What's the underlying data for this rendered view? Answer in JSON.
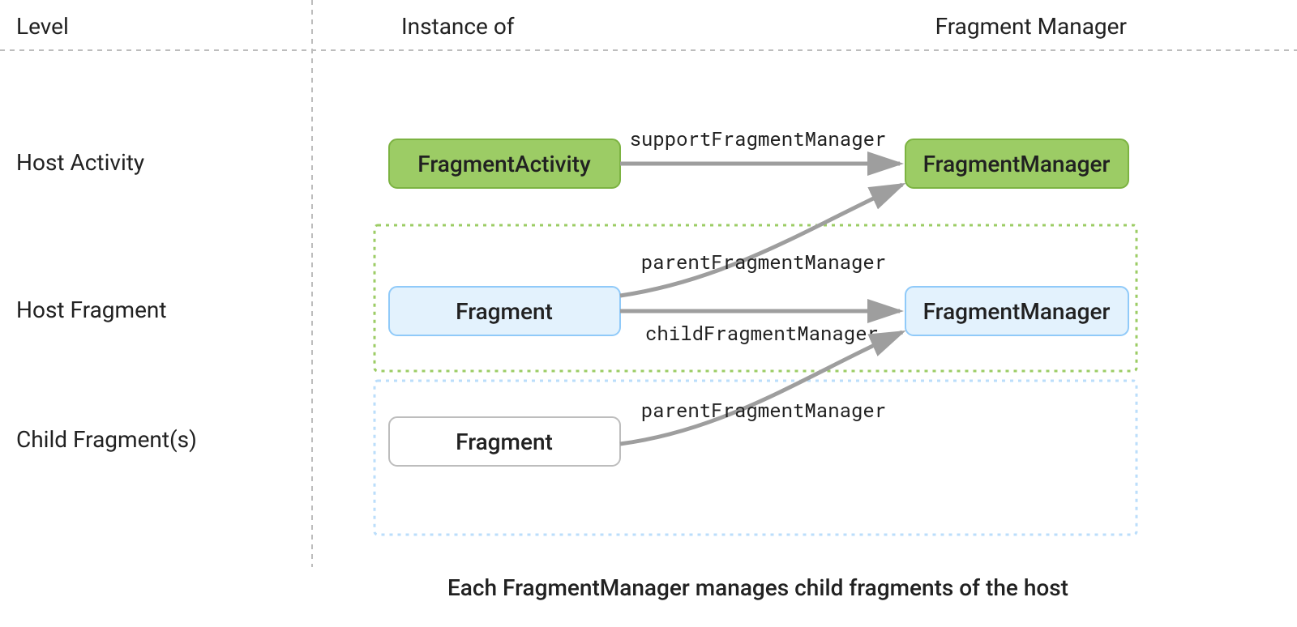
{
  "headers": {
    "level": "Level",
    "instance_of": "Instance of",
    "fragment_manager": "Fragment Manager"
  },
  "levels": {
    "host_activity": "Host Activity",
    "host_fragment": "Host Fragment",
    "child_fragments": "Child Fragment(s)"
  },
  "nodes": {
    "fragment_activity": "FragmentActivity",
    "fragment_manager_1": "FragmentManager",
    "fragment_1": "Fragment",
    "fragment_manager_2": "FragmentManager",
    "fragment_2": "Fragment"
  },
  "edges": {
    "support_fm": "supportFragmentManager",
    "parent_fm_1": "parentFragmentManager",
    "child_fm": "childFragmentManager",
    "parent_fm_2": "parentFragmentManager"
  },
  "caption": "Each FragmentManager manages child fragments of the host",
  "colors": {
    "green_fill": "#9CCC65",
    "green_stroke": "#7CB342",
    "blue_fill": "#E3F2FD",
    "blue_stroke": "#90CAF9",
    "white_fill": "#FFFFFF",
    "gray_stroke": "#BDBDBD",
    "arrow": "#9E9E9E",
    "dashed": "#BDBDBD",
    "green_dotted": "#9CCC65",
    "blue_dotted": "#BBDEFB"
  }
}
